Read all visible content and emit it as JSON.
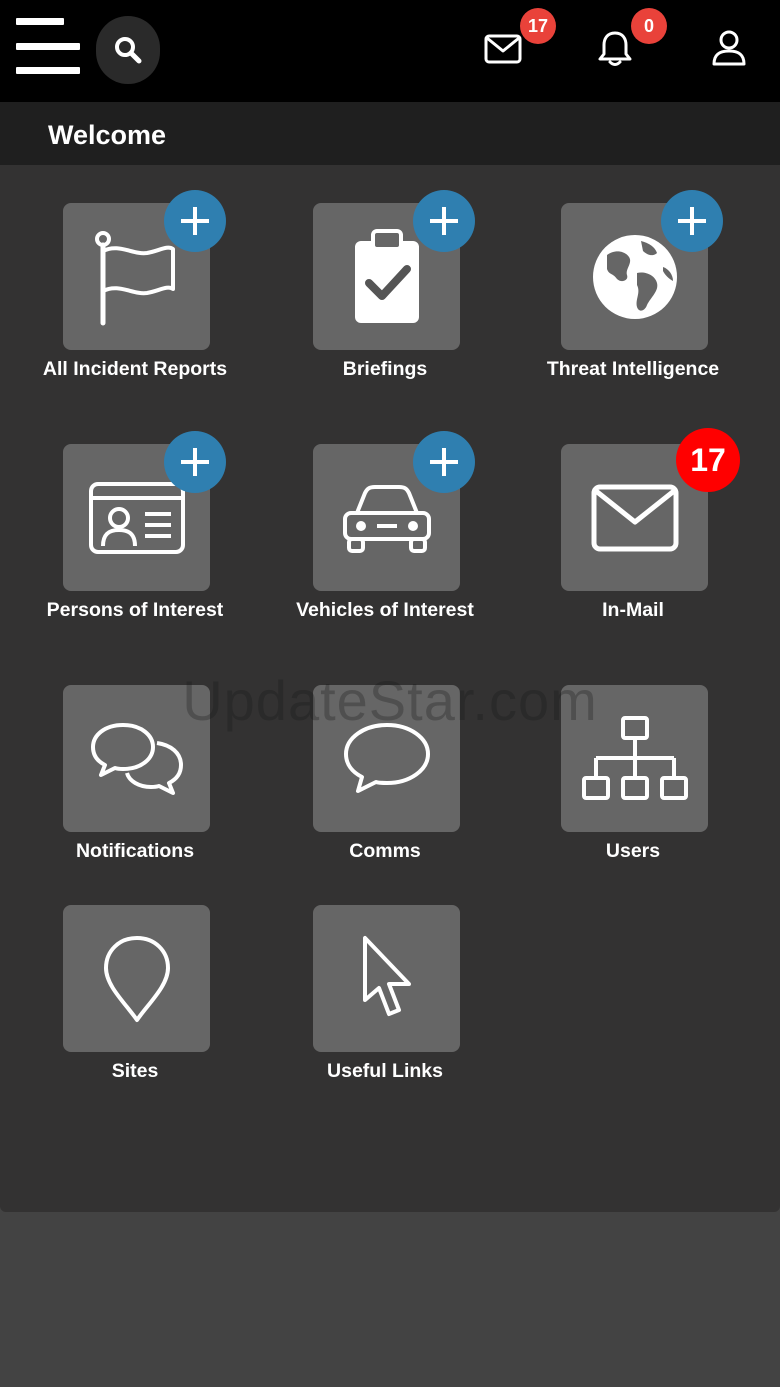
{
  "header": {
    "mail_badge": "17",
    "notification_badge": "0"
  },
  "welcome": {
    "title": "Welcome"
  },
  "tiles": {
    "all_incident_reports": "All Incident Reports",
    "briefings": "Briefings",
    "threat_intelligence": "Threat Intelligence",
    "persons_of_interest": "Persons of Interest",
    "vehicles_of_interest": "Vehicles of Interest",
    "in_mail": "In-Mail",
    "in_mail_badge": "17",
    "notifications": "Notifications",
    "comms": "Comms",
    "users": "Users",
    "sites": "Sites",
    "useful_links": "Useful Links"
  },
  "watermark": "UpdateStar.com",
  "colors": {
    "topbar": "#000000",
    "welcome_bar": "#1f1f1f",
    "panel": "#333232",
    "tile": "#666666",
    "plus_button": "#2f7fb0",
    "badge_header": "#e9423a",
    "badge_tile": "#ff0000"
  }
}
